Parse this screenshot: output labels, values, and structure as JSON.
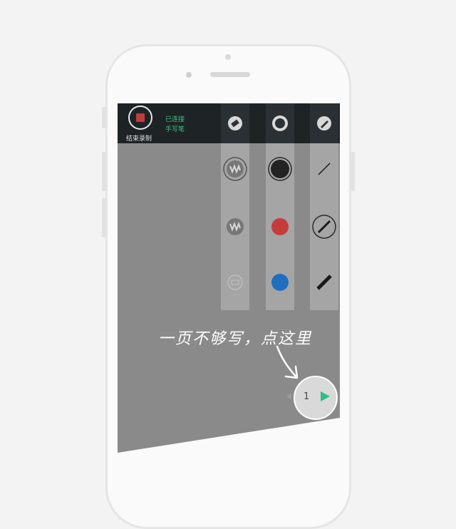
{
  "recorder": {
    "stop_label": "结束录制",
    "connection_status": "已连接",
    "device_name": "手写笔"
  },
  "toolbar": {
    "tools": [
      "eraser-icon",
      "color-dot-icon",
      "pen-icon"
    ]
  },
  "palettes": {
    "eraser_options": [
      "eraser-large-icon",
      "eraser-medium-icon",
      "clear-all-icon"
    ],
    "color_options": [
      "#232323",
      "#c63c3c",
      "#1f6fbf"
    ],
    "stroke_options": [
      "thin",
      "medium",
      "thick"
    ]
  },
  "annotation": {
    "hint_text": "一页不够写，点这里"
  },
  "pager": {
    "current_page": "1"
  },
  "colors": {
    "accent": "#3fbe80",
    "record": "#c33c3c",
    "topbar": "#1e2326"
  }
}
